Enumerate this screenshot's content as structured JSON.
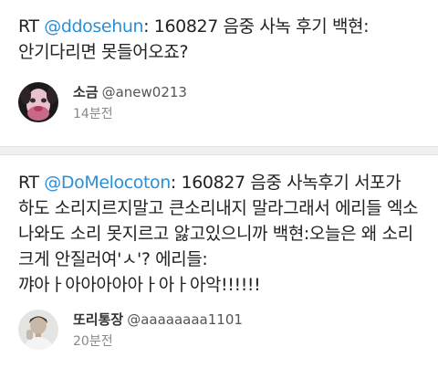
{
  "tweets": [
    {
      "rt_prefix": "RT ",
      "mention": "@ddosehun",
      "text": ": 160827 음중 사녹 후기 백현: 안기다리면 못들어오죠?",
      "author_name": "소금",
      "author_handle": "@anew0213",
      "timestamp": "14분전",
      "avatar_icon": "profile-photo-icon"
    },
    {
      "rt_prefix": "RT ",
      "mention": "@DoMelocoton",
      "text": ": 160827 음중 사녹후기 서포가 하도 소리지르지말고 큰소리내지 말라그래서 에리들 엑소 나와도 소리 못지르고 앓고있으니까 백현:오늘은 왜 소리 크게 안질러여'ㅅ'? 에리들:꺄아ㅏ아아아아아ㅏ아ㅏ아악!!!!!!",
      "author_name": "또리통장",
      "author_handle": "@aaaaaaaa1101",
      "timestamp": "20분전",
      "avatar_icon": "profile-photo-icon"
    }
  ]
}
